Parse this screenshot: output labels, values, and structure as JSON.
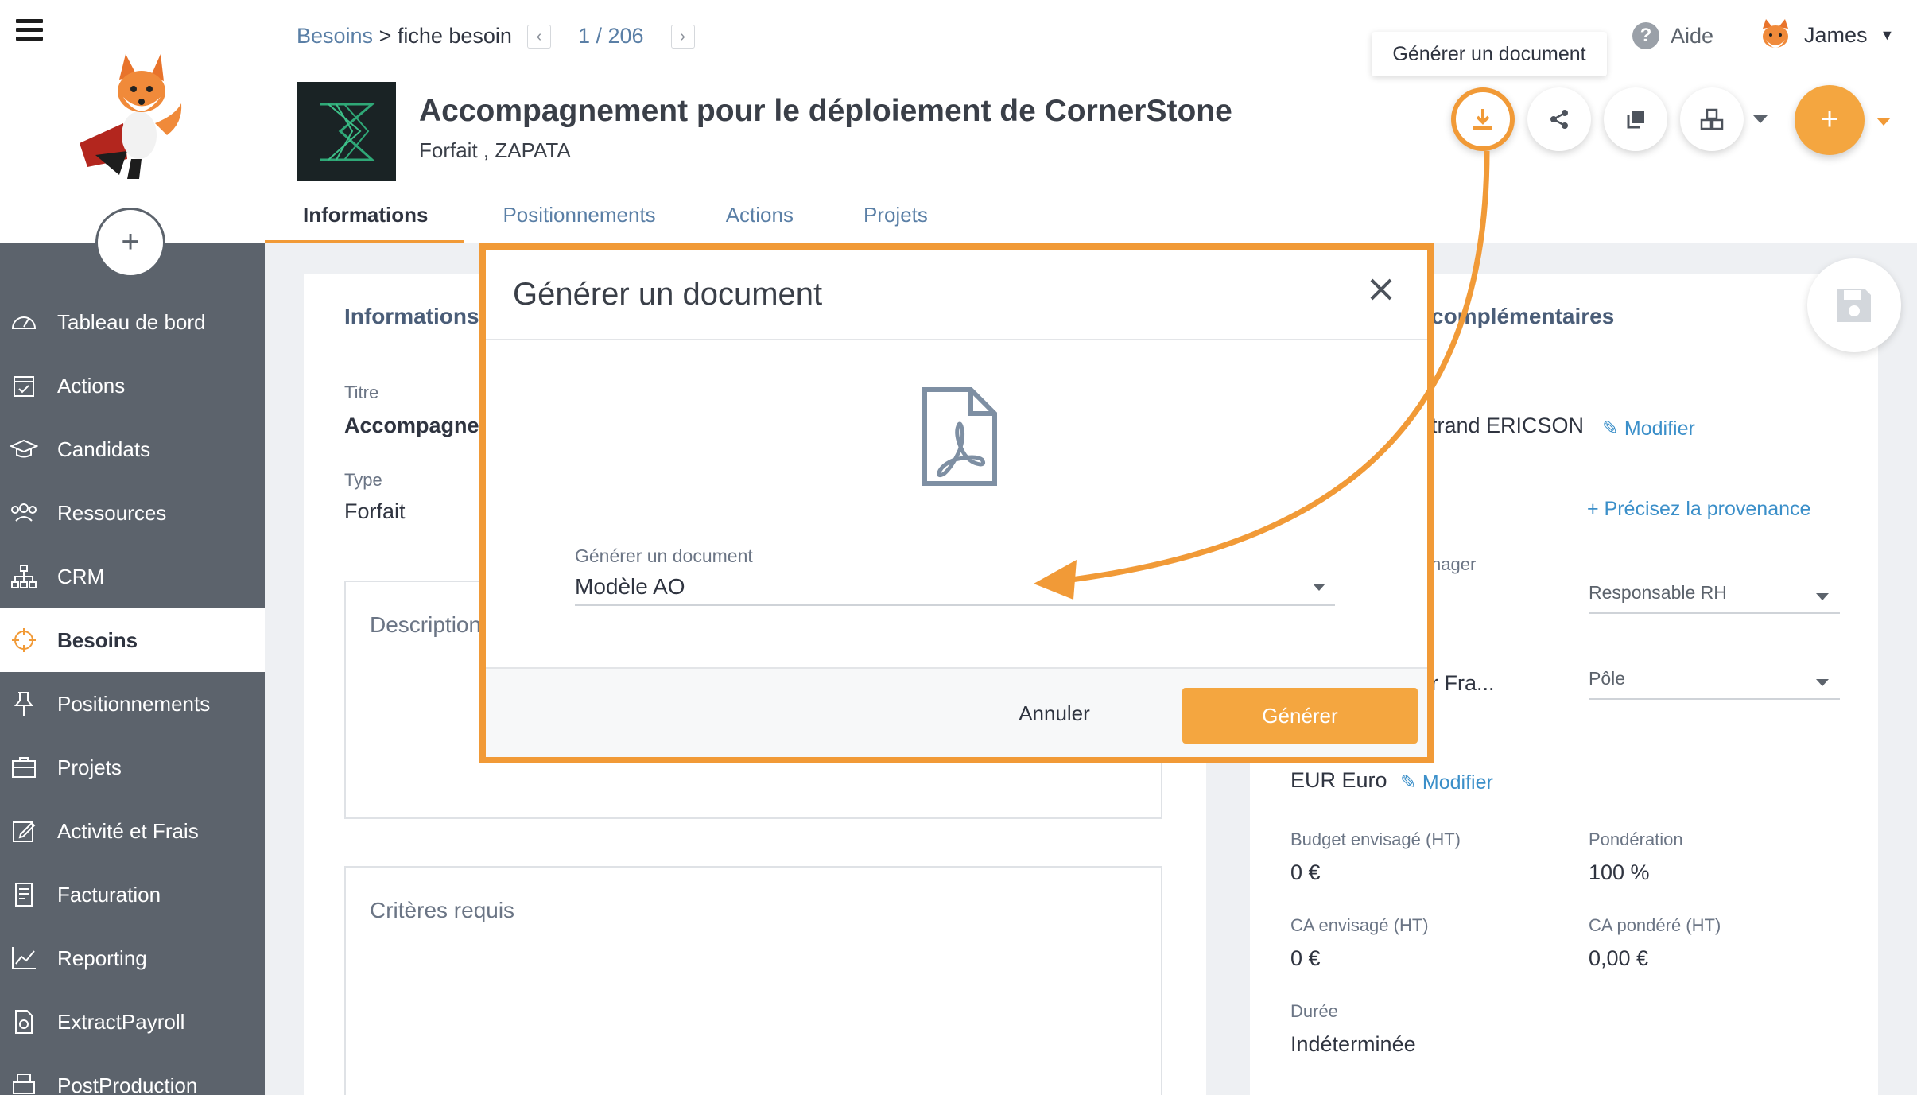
{
  "sidebar": {
    "items": [
      {
        "label": "Tableau de bord",
        "icon": "dashboard-icon"
      },
      {
        "label": "Actions",
        "icon": "calendar-check-icon"
      },
      {
        "label": "Candidats",
        "icon": "graduation-cap-icon"
      },
      {
        "label": "Ressources",
        "icon": "people-icon"
      },
      {
        "label": "CRM",
        "icon": "org-chart-icon"
      },
      {
        "label": "Besoins",
        "icon": "crosshair-icon",
        "active": true
      },
      {
        "label": "Positionnements",
        "icon": "pin-icon"
      },
      {
        "label": "Projets",
        "icon": "briefcase-icon"
      },
      {
        "label": "Activité et Frais",
        "icon": "edit-icon"
      },
      {
        "label": "Facturation",
        "icon": "invoice-icon"
      },
      {
        "label": "Reporting",
        "icon": "chart-line-icon"
      },
      {
        "label": "ExtractPayroll",
        "icon": "file-export-icon"
      },
      {
        "label": "PostProduction",
        "icon": "printer-icon"
      }
    ]
  },
  "header": {
    "breadcrumb_parent": "Besoins",
    "breadcrumb_sep": " > ",
    "breadcrumb_current": "fiche besoin",
    "pager": "1 / 206",
    "help": "Aide",
    "user": "James",
    "tooltip": "Générer un document",
    "title": "Accompagnement pour le déploiement de CornerStone",
    "subtitle": "Forfait , ZAPATA"
  },
  "tabs": [
    "Informations",
    "Positionnements",
    "Actions",
    "Projets"
  ],
  "left_card": {
    "section_title": "Informations",
    "titre_label": "Titre",
    "titre_value": "Accompagner",
    "type_label": "Type",
    "type_value": "Forfait",
    "description_label": "Description",
    "criteres_label": "Critères requis"
  },
  "right_card": {
    "section_title": "complémentaires",
    "contact_value": "trand ERICSON",
    "modifier": "Modifier",
    "provenance_link": "+ Précisez la provenance",
    "manager_label": "nager",
    "responsable_select": "Responsable RH",
    "agence_value": "r Fra...",
    "pole_select": "Pôle",
    "currency_value": "EUR Euro",
    "currency_modifier": "Modifier",
    "budget_label": "Budget envisagé (HT)",
    "budget_value": "0 €",
    "ponderation_label": "Pondération",
    "ponderation_value": "100 %",
    "ca_label": "CA envisagé (HT)",
    "ca_value": "0 €",
    "ca_pondere_label": "CA pondéré (HT)",
    "ca_pondere_value": "0,00 €",
    "duree_label": "Durée",
    "duree_value": "Indéterminée"
  },
  "modal": {
    "title": "Générer un document",
    "field_label": "Générer un document",
    "field_value": "Modèle AO",
    "cancel": "Annuler",
    "generate": "Générer"
  },
  "colors": {
    "accent": "#f4a640",
    "highlight": "#f19a37",
    "sidebar": "#5c636c",
    "link": "#3b8fc9"
  }
}
